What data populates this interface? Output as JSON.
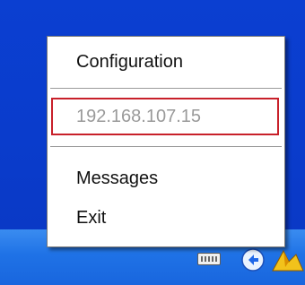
{
  "tray_menu": {
    "items": {
      "configuration": "Configuration",
      "ip_address": "192.168.107.15",
      "messages": "Messages",
      "exit": "Exit"
    }
  },
  "taskbar": {
    "tray_icons": [
      "keyboard-icon",
      "network-icon",
      "app-icon"
    ]
  },
  "colors": {
    "desktop_blue": "#0a3fd0",
    "taskbar_blue": "#1f72e6",
    "highlight_red": "#c8202a",
    "disabled_text": "#9a9a9a"
  }
}
